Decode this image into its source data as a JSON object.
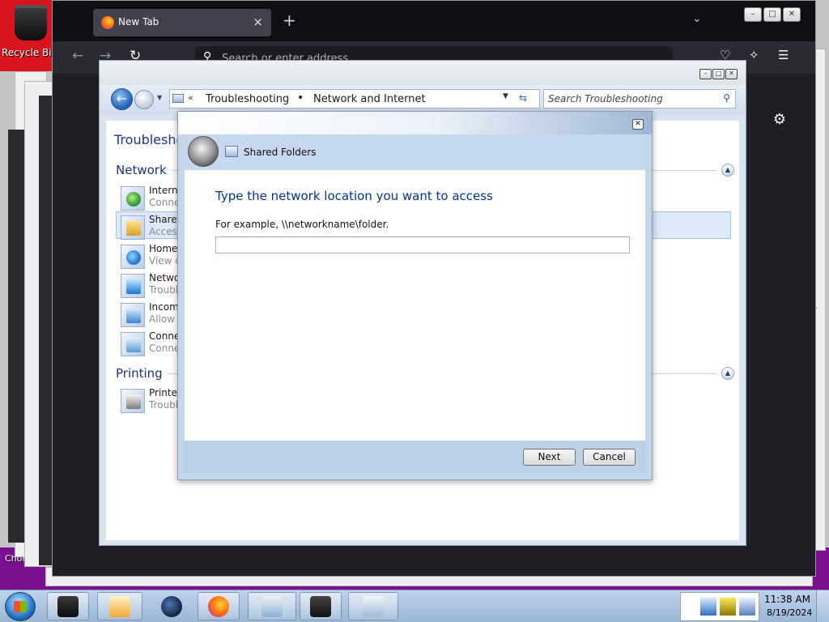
{
  "desktop": {
    "recycle_bin_label": "Recycle Bi",
    "chrome_label": "Chom"
  },
  "firefox": {
    "tab_title": "New Tab",
    "tab_close": "×",
    "new_tab_glyph": "+",
    "list_tabs_glyph": "⌄",
    "back_glyph": "←",
    "forward_glyph": "→",
    "reload_glyph": "↻",
    "search_glyph": "⚲",
    "url_placeholder": "Search or enter address",
    "pocket_glyph": "♡",
    "extensions_glyph": "✧",
    "menu_glyph": "☰",
    "settings_glyph": "⚙",
    "window_buttons": [
      "–",
      "□",
      "✕"
    ]
  },
  "control_panel": {
    "window_buttons": [
      "–",
      "□",
      "✕"
    ],
    "back_glyph": "←",
    "history_glyph": "▼",
    "crumb_chevron": "«",
    "breadcrumb": [
      "Troubleshooting",
      "Network and Internet"
    ],
    "breadcrumb_separator": "•",
    "dropdown_glyph": "▼",
    "refresh_glyph": "⇆",
    "search_placeholder": "Search Troubleshooting",
    "search_glyph": "⚲",
    "page_title": "Troubleshoo",
    "collapse_glyph": "▲",
    "sections": [
      {
        "name": "Network",
        "items": [
          {
            "title": "Interne",
            "subtitle": "Conne",
            "icon": "globe-icon"
          },
          {
            "title": "Shared",
            "subtitle": "Access",
            "icon": "shared-folder-icon"
          },
          {
            "title": "Home",
            "subtitle": "View c",
            "icon": "homegroup-icon"
          },
          {
            "title": "Netwo",
            "subtitle": "Troubl",
            "icon": "network-adapter-icon"
          },
          {
            "title": "Incom",
            "subtitle": "Allow",
            "icon": "incoming-connections-icon"
          },
          {
            "title": "Conne",
            "subtitle": "Conne",
            "icon": "workplace-connection-icon"
          }
        ]
      },
      {
        "name": "Printing",
        "items": [
          {
            "title": "Printer",
            "subtitle": "Troubl",
            "icon": "printer-icon"
          }
        ]
      }
    ]
  },
  "dialog": {
    "close_glyph": "✕",
    "header_title": "Shared Folders",
    "heading": "Type the network location you want to access",
    "example_text": "For example, \\\\networkname\\folder.",
    "input_value": "",
    "next_label": "Next",
    "cancel_label": "Cancel"
  },
  "taskbar": {
    "clock_time": "11:38 AM",
    "clock_date": "8/19/2024",
    "buttons": [
      "terminal-icon",
      "media-player-icon",
      "globe-browser-icon",
      "firefox-icon",
      "snipping-tool-icon",
      "display-icon",
      "troubleshooting-icon"
    ]
  },
  "colors": {
    "accent_blue": "#003399",
    "section_blue": "#1e3287",
    "purple_band": "#7a0f8f",
    "recycle_red": "#d8141c"
  }
}
